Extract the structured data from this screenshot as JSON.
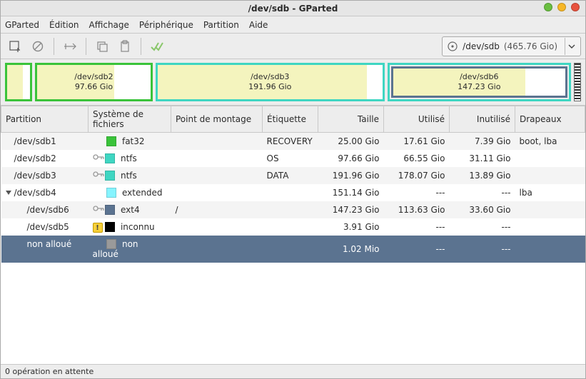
{
  "window": {
    "title": "/dev/sdb - GParted"
  },
  "menu": {
    "gparted": "GParted",
    "edition": "Édition",
    "affichage": "Affichage",
    "peripherique": "Périphérique",
    "partition": "Partition",
    "aide": "Aide"
  },
  "toolbar": {
    "device": {
      "name": "/dev/sdb",
      "size": "(465.76 Gio)"
    }
  },
  "viz": {
    "sdb1": {
      "border": "#3ac33a",
      "fillPct": 70
    },
    "sdb2": {
      "label": "/dev/sdb2",
      "size": "97.66 Gio",
      "border": "#3ac33a",
      "fillPct": 68
    },
    "sdb3": {
      "label": "/dev/sdb3",
      "size": "191.96 Gio",
      "border": "#3fd6c2",
      "fillPct": 93
    },
    "sdb6": {
      "label": "/dev/sdb6",
      "size": "147.23 Gio",
      "borderOuter": "#3fd6c2",
      "borderInner": "#5b7390",
      "fillPct": 77
    }
  },
  "columns": {
    "partition": "Partition",
    "fs": "Système de fichiers",
    "mount": "Point de montage",
    "label": "Étiquette",
    "size": "Taille",
    "used": "Utilisé",
    "unused": "Inutilisé",
    "flags": "Drapeaux"
  },
  "rows": [
    {
      "indent": 0,
      "expand": "",
      "name": "/dev/sdb1",
      "key": false,
      "warn": false,
      "color": "#3ac33a",
      "fs": "fat32",
      "mount": "",
      "label": "RECOVERY",
      "size": "25.00 Gio",
      "used": "17.61 Gio",
      "unused": "7.39 Gio",
      "flags": "boot, lba",
      "selected": false
    },
    {
      "indent": 0,
      "expand": "",
      "name": "/dev/sdb2",
      "key": true,
      "warn": false,
      "color": "#3fd6c2",
      "fs": "ntfs",
      "mount": "",
      "label": "OS",
      "size": "97.66 Gio",
      "used": "66.55 Gio",
      "unused": "31.11 Gio",
      "flags": "",
      "selected": false
    },
    {
      "indent": 0,
      "expand": "",
      "name": "/dev/sdb3",
      "key": true,
      "warn": false,
      "color": "#3fd6c2",
      "fs": "ntfs",
      "mount": "",
      "label": "DATA",
      "size": "191.96 Gio",
      "used": "178.07 Gio",
      "unused": "13.89 Gio",
      "flags": "",
      "selected": false
    },
    {
      "indent": 0,
      "expand": "tri",
      "name": "/dev/sdb4",
      "key": false,
      "warn": false,
      "color": "#86f4ff",
      "fs": "extended",
      "mount": "",
      "label": "",
      "size": "151.14 Gio",
      "used": "---",
      "unused": "---",
      "flags": "lba",
      "selected": false
    },
    {
      "indent": 1,
      "expand": "",
      "name": "/dev/sdb6",
      "key": true,
      "warn": false,
      "color": "#5b7390",
      "fs": "ext4",
      "mount": "/",
      "label": "",
      "size": "147.23 Gio",
      "used": "113.63 Gio",
      "unused": "33.60 Gio",
      "flags": "",
      "selected": false
    },
    {
      "indent": 1,
      "expand": "",
      "name": "/dev/sdb5",
      "key": false,
      "warn": true,
      "color": "#000000",
      "fs": "inconnu",
      "mount": "",
      "label": "",
      "size": "3.91 Gio",
      "used": "---",
      "unused": "---",
      "flags": "",
      "selected": false
    },
    {
      "indent": 1,
      "expand": "",
      "name": "non alloué",
      "key": false,
      "warn": false,
      "color": "#9a9a9a",
      "fs": "non alloué",
      "mount": "",
      "label": "",
      "size": "1.02 Mio",
      "used": "---",
      "unused": "---",
      "flags": "",
      "selected": true
    }
  ],
  "status": {
    "text": "0 opération en attente"
  }
}
